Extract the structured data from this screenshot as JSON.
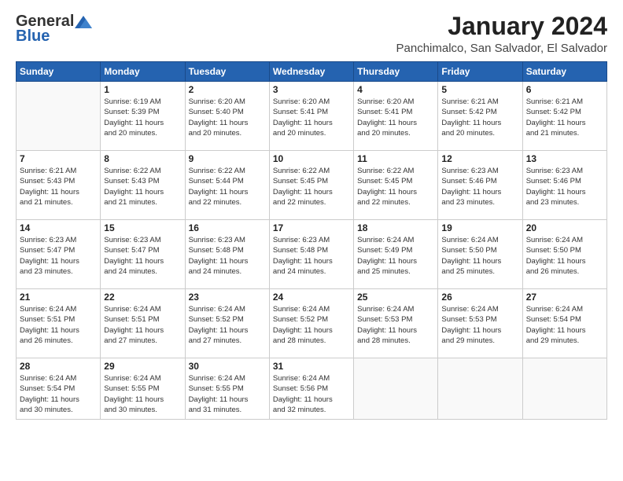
{
  "logo": {
    "general": "General",
    "blue": "Blue"
  },
  "header": {
    "title": "January 2024",
    "location": "Panchimalco, San Salvador, El Salvador"
  },
  "weekdays": [
    "Sunday",
    "Monday",
    "Tuesday",
    "Wednesday",
    "Thursday",
    "Friday",
    "Saturday"
  ],
  "weeks": [
    [
      {
        "day": "",
        "info": ""
      },
      {
        "day": "1",
        "info": "Sunrise: 6:19 AM\nSunset: 5:39 PM\nDaylight: 11 hours\nand 20 minutes."
      },
      {
        "day": "2",
        "info": "Sunrise: 6:20 AM\nSunset: 5:40 PM\nDaylight: 11 hours\nand 20 minutes."
      },
      {
        "day": "3",
        "info": "Sunrise: 6:20 AM\nSunset: 5:41 PM\nDaylight: 11 hours\nand 20 minutes."
      },
      {
        "day": "4",
        "info": "Sunrise: 6:20 AM\nSunset: 5:41 PM\nDaylight: 11 hours\nand 20 minutes."
      },
      {
        "day": "5",
        "info": "Sunrise: 6:21 AM\nSunset: 5:42 PM\nDaylight: 11 hours\nand 20 minutes."
      },
      {
        "day": "6",
        "info": "Sunrise: 6:21 AM\nSunset: 5:42 PM\nDaylight: 11 hours\nand 21 minutes."
      }
    ],
    [
      {
        "day": "7",
        "info": "Sunrise: 6:21 AM\nSunset: 5:43 PM\nDaylight: 11 hours\nand 21 minutes."
      },
      {
        "day": "8",
        "info": "Sunrise: 6:22 AM\nSunset: 5:43 PM\nDaylight: 11 hours\nand 21 minutes."
      },
      {
        "day": "9",
        "info": "Sunrise: 6:22 AM\nSunset: 5:44 PM\nDaylight: 11 hours\nand 22 minutes."
      },
      {
        "day": "10",
        "info": "Sunrise: 6:22 AM\nSunset: 5:45 PM\nDaylight: 11 hours\nand 22 minutes."
      },
      {
        "day": "11",
        "info": "Sunrise: 6:22 AM\nSunset: 5:45 PM\nDaylight: 11 hours\nand 22 minutes."
      },
      {
        "day": "12",
        "info": "Sunrise: 6:23 AM\nSunset: 5:46 PM\nDaylight: 11 hours\nand 23 minutes."
      },
      {
        "day": "13",
        "info": "Sunrise: 6:23 AM\nSunset: 5:46 PM\nDaylight: 11 hours\nand 23 minutes."
      }
    ],
    [
      {
        "day": "14",
        "info": "Sunrise: 6:23 AM\nSunset: 5:47 PM\nDaylight: 11 hours\nand 23 minutes."
      },
      {
        "day": "15",
        "info": "Sunrise: 6:23 AM\nSunset: 5:47 PM\nDaylight: 11 hours\nand 24 minutes."
      },
      {
        "day": "16",
        "info": "Sunrise: 6:23 AM\nSunset: 5:48 PM\nDaylight: 11 hours\nand 24 minutes."
      },
      {
        "day": "17",
        "info": "Sunrise: 6:23 AM\nSunset: 5:48 PM\nDaylight: 11 hours\nand 24 minutes."
      },
      {
        "day": "18",
        "info": "Sunrise: 6:24 AM\nSunset: 5:49 PM\nDaylight: 11 hours\nand 25 minutes."
      },
      {
        "day": "19",
        "info": "Sunrise: 6:24 AM\nSunset: 5:50 PM\nDaylight: 11 hours\nand 25 minutes."
      },
      {
        "day": "20",
        "info": "Sunrise: 6:24 AM\nSunset: 5:50 PM\nDaylight: 11 hours\nand 26 minutes."
      }
    ],
    [
      {
        "day": "21",
        "info": "Sunrise: 6:24 AM\nSunset: 5:51 PM\nDaylight: 11 hours\nand 26 minutes."
      },
      {
        "day": "22",
        "info": "Sunrise: 6:24 AM\nSunset: 5:51 PM\nDaylight: 11 hours\nand 27 minutes."
      },
      {
        "day": "23",
        "info": "Sunrise: 6:24 AM\nSunset: 5:52 PM\nDaylight: 11 hours\nand 27 minutes."
      },
      {
        "day": "24",
        "info": "Sunrise: 6:24 AM\nSunset: 5:52 PM\nDaylight: 11 hours\nand 28 minutes."
      },
      {
        "day": "25",
        "info": "Sunrise: 6:24 AM\nSunset: 5:53 PM\nDaylight: 11 hours\nand 28 minutes."
      },
      {
        "day": "26",
        "info": "Sunrise: 6:24 AM\nSunset: 5:53 PM\nDaylight: 11 hours\nand 29 minutes."
      },
      {
        "day": "27",
        "info": "Sunrise: 6:24 AM\nSunset: 5:54 PM\nDaylight: 11 hours\nand 29 minutes."
      }
    ],
    [
      {
        "day": "28",
        "info": "Sunrise: 6:24 AM\nSunset: 5:54 PM\nDaylight: 11 hours\nand 30 minutes."
      },
      {
        "day": "29",
        "info": "Sunrise: 6:24 AM\nSunset: 5:55 PM\nDaylight: 11 hours\nand 30 minutes."
      },
      {
        "day": "30",
        "info": "Sunrise: 6:24 AM\nSunset: 5:55 PM\nDaylight: 11 hours\nand 31 minutes."
      },
      {
        "day": "31",
        "info": "Sunrise: 6:24 AM\nSunset: 5:56 PM\nDaylight: 11 hours\nand 32 minutes."
      },
      {
        "day": "",
        "info": ""
      },
      {
        "day": "",
        "info": ""
      },
      {
        "day": "",
        "info": ""
      }
    ]
  ]
}
